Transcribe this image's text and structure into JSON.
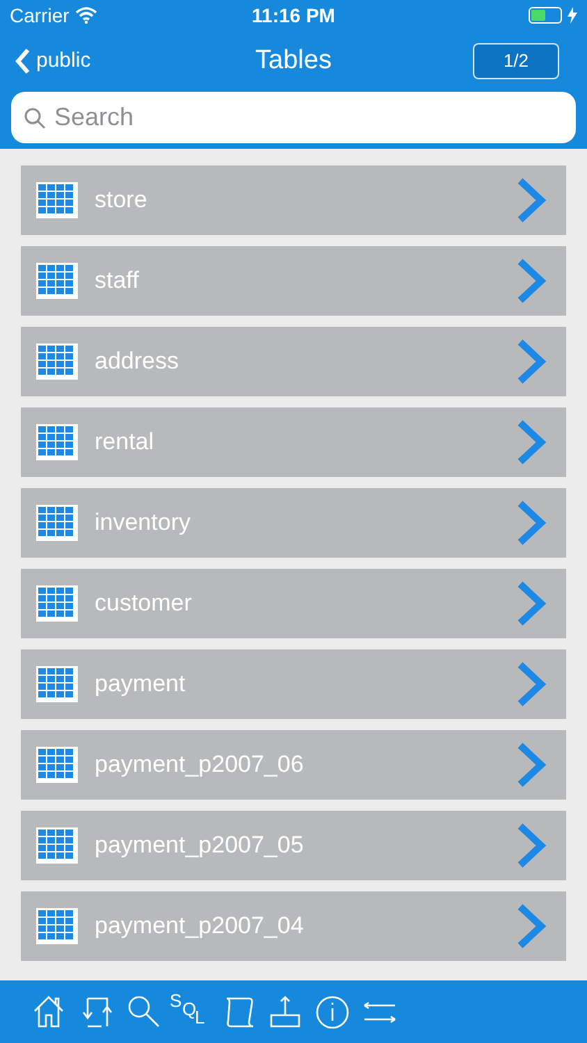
{
  "status_bar": {
    "carrier": "Carrier",
    "time": "11:16 PM"
  },
  "nav": {
    "back": "public",
    "title": "Tables",
    "page": "1/2"
  },
  "search": {
    "placeholder": "Search"
  },
  "tables": [
    {
      "name": "store"
    },
    {
      "name": "staff"
    },
    {
      "name": "address"
    },
    {
      "name": "rental"
    },
    {
      "name": "inventory"
    },
    {
      "name": "customer"
    },
    {
      "name": "payment"
    },
    {
      "name": "payment_p2007_06"
    },
    {
      "name": "payment_p2007_05"
    },
    {
      "name": "payment_p2007_04"
    }
  ],
  "toolbar": [
    {
      "kind": "home"
    },
    {
      "kind": "swap"
    },
    {
      "kind": "search"
    },
    {
      "kind": "sql",
      "label": "SQL"
    },
    {
      "kind": "scroll"
    },
    {
      "kind": "export"
    },
    {
      "kind": "info"
    },
    {
      "kind": "arrows"
    }
  ]
}
